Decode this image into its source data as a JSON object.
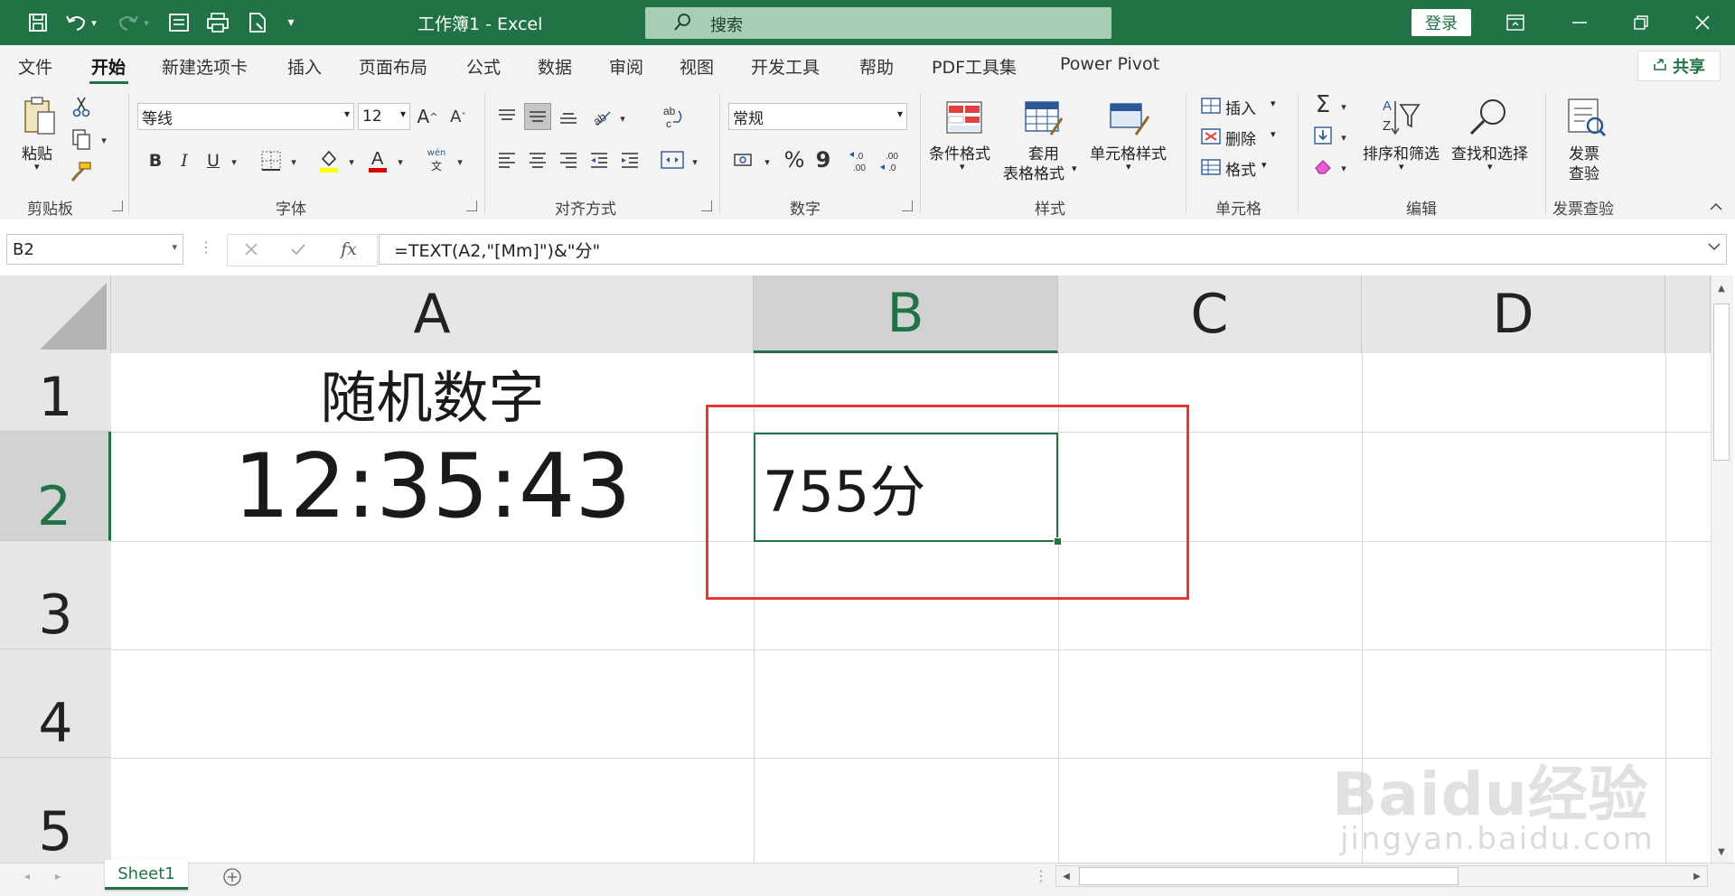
{
  "window": {
    "title": "工作簿1  -  Excel",
    "search_placeholder": "搜索",
    "login_label": "登录",
    "share_label": "共享"
  },
  "menu_tabs": [
    "文件",
    "开始",
    "新建选项卡",
    "插入",
    "页面布局",
    "公式",
    "数据",
    "审阅",
    "视图",
    "开发工具",
    "帮助",
    "PDF工具集",
    "Power Pivot"
  ],
  "active_tab": "开始",
  "ribbon": {
    "clipboard": {
      "paste_label": "粘贴",
      "group_label": "剪贴板"
    },
    "font": {
      "font_name": "等线",
      "font_size": "12",
      "bold": "B",
      "italic": "I",
      "underline": "U",
      "phonetic": "wén",
      "group_label": "字体"
    },
    "alignment": {
      "group_label": "对齐方式"
    },
    "number": {
      "format": "常规",
      "percent": "%",
      "comma": "9",
      "group_label": "数字"
    },
    "styles": {
      "conditional_format": "条件格式",
      "table_format_line1": "套用",
      "table_format_line2": "表格格式",
      "cell_styles": "单元格样式",
      "group_label": "样式"
    },
    "cells": {
      "insert": "插入",
      "delete": "删除",
      "format": "格式",
      "group_label": "单元格"
    },
    "editing": {
      "sort_filter": "排序和筛选",
      "find_select": "查找和选择",
      "group_label": "编辑"
    },
    "invoice": {
      "check_line1": "发票",
      "check_line2": "查验",
      "group_label": "发票查验"
    }
  },
  "formula_bar": {
    "name_box": "B2",
    "fx": "fx",
    "formula": "=TEXT(A2,\"[Mm]\")&\"分\""
  },
  "columns": [
    "A",
    "B",
    "C",
    "D"
  ],
  "rows": [
    "1",
    "2",
    "3",
    "4",
    "5"
  ],
  "cells": {
    "A1": "随机数字",
    "A2": "12:35:43",
    "B2": "755分"
  },
  "selected_cell": "B2",
  "sheets": [
    "Sheet1"
  ],
  "watermark": {
    "logo": "Baidu经验",
    "url": "jingyan.baidu.com"
  },
  "colors": {
    "accent": "#217346",
    "highlight_box": "#e53935"
  }
}
